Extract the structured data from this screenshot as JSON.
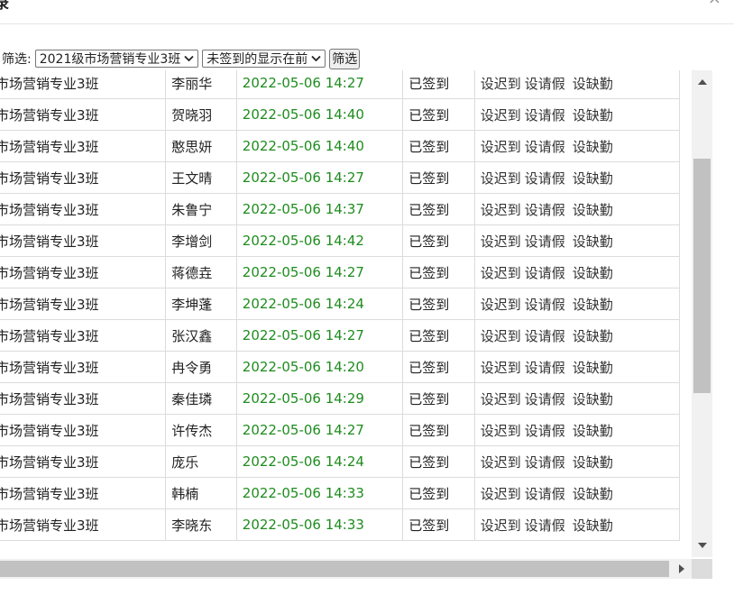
{
  "dialog": {
    "title": "录",
    "close_glyph": "×"
  },
  "filter": {
    "label": "筛选:",
    "class_select": "2021级市场营销专业3班",
    "order_select": "未签到的显示在前",
    "button": "筛选"
  },
  "actions": {
    "late": "设迟到",
    "leave": "设请假",
    "absent": "设缺勤"
  },
  "rows": [
    {
      "class": "市场营销专业3班",
      "name": "李丽华",
      "time": "2022-05-06 14:27",
      "status": "已签到"
    },
    {
      "class": "市场营销专业3班",
      "name": "贺晓羽",
      "time": "2022-05-06 14:40",
      "status": "已签到"
    },
    {
      "class": "市场营销专业3班",
      "name": "憨思妍",
      "time": "2022-05-06 14:40",
      "status": "已签到"
    },
    {
      "class": "市场营销专业3班",
      "name": "王文晴",
      "time": "2022-05-06 14:27",
      "status": "已签到"
    },
    {
      "class": "市场营销专业3班",
      "name": "朱鲁宁",
      "time": "2022-05-06 14:37",
      "status": "已签到"
    },
    {
      "class": "市场营销专业3班",
      "name": "李增剑",
      "time": "2022-05-06 14:42",
      "status": "已签到"
    },
    {
      "class": "市场营销专业3班",
      "name": "蒋德垚",
      "time": "2022-05-06 14:27",
      "status": "已签到"
    },
    {
      "class": "市场营销专业3班",
      "name": "李坤蓬",
      "time": "2022-05-06 14:24",
      "status": "已签到"
    },
    {
      "class": "市场营销专业3班",
      "name": "张汉鑫",
      "time": "2022-05-06 14:27",
      "status": "已签到"
    },
    {
      "class": "市场营销专业3班",
      "name": "冉令勇",
      "time": "2022-05-06 14:20",
      "status": "已签到"
    },
    {
      "class": "市场营销专业3班",
      "name": "秦佳璘",
      "time": "2022-05-06 14:29",
      "status": "已签到"
    },
    {
      "class": "市场营销专业3班",
      "name": "许传杰",
      "time": "2022-05-06 14:27",
      "status": "已签到"
    },
    {
      "class": "市场营销专业3班",
      "name": "庞乐",
      "time": "2022-05-06 14:24",
      "status": "已签到"
    },
    {
      "class": "市场营销专业3班",
      "name": "韩楠",
      "time": "2022-05-06 14:33",
      "status": "已签到"
    },
    {
      "class": "市场营销专业3班",
      "name": "李晓东",
      "time": "2022-05-06 14:33",
      "status": "已签到"
    }
  ],
  "colors": {
    "time_text": "#1e8c1e",
    "border": "#dcdcdc",
    "scroll_thumb": "#c1c1c1"
  },
  "icons": {
    "close": "close-icon",
    "select_chevron": "chevron-down-icon",
    "scroll_up": "arrow-up-icon",
    "scroll_down": "arrow-down-icon",
    "scroll_right": "arrow-right-icon"
  }
}
